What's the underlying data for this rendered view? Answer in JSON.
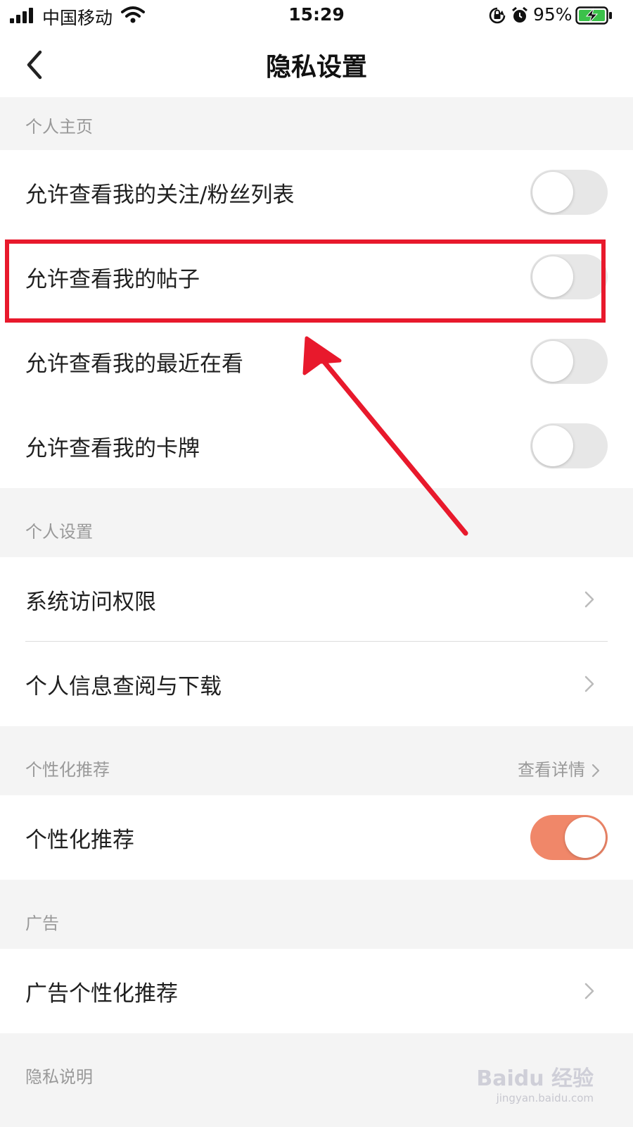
{
  "status_bar": {
    "carrier": "中国移动",
    "time": "15:29",
    "battery_percent": "95%",
    "icons": [
      "signal-icon",
      "wifi-icon",
      "orientation-lock-icon",
      "alarm-icon",
      "battery-charging-icon"
    ]
  },
  "nav": {
    "title": "隐私设置",
    "back_icon": "chevron-left-icon"
  },
  "sections": {
    "profile": {
      "header": "个人主页",
      "items": [
        {
          "label": "允许查看我的关注/粉丝列表",
          "enabled": false
        },
        {
          "label": "允许查看我的帖子",
          "enabled": false
        },
        {
          "label": "允许查看我的最近在看",
          "enabled": false
        },
        {
          "label": "允许查看我的卡牌",
          "enabled": false
        }
      ]
    },
    "personal_settings": {
      "header": "个人设置",
      "items": [
        {
          "label": "系统访问权限"
        },
        {
          "label": "个人信息查阅与下载"
        }
      ]
    },
    "personalization": {
      "header": "个性化推荐",
      "action": "查看详情",
      "items": [
        {
          "label": "个性化推荐",
          "enabled": true
        }
      ]
    },
    "ads": {
      "header": "广告",
      "items": [
        {
          "label": "广告个性化推荐"
        }
      ]
    },
    "privacy_notes": {
      "header": "隐私说明"
    }
  },
  "watermark": {
    "brand": "Baidu 经验",
    "url": "jingyan.baidu.com"
  },
  "colors": {
    "toggle_on": "#f08769",
    "toggle_off": "#e7e7e7",
    "annotation": "#e8192c",
    "section_bg": "#f4f4f4",
    "secondary_text": "#999999",
    "battery_fill": "#3bc14a"
  }
}
